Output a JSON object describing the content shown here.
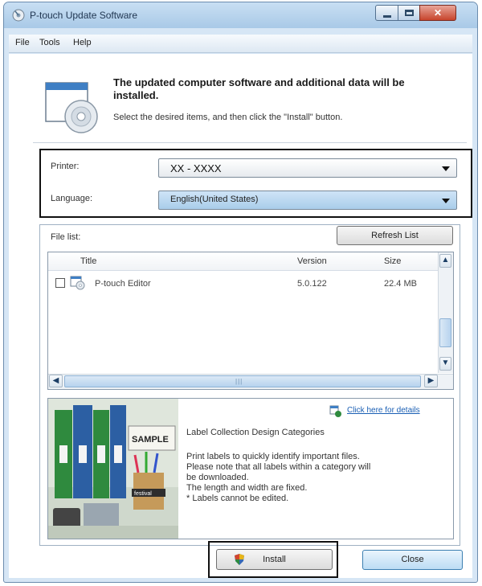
{
  "window": {
    "title": "P-touch Update Software"
  },
  "menu": {
    "items": [
      "File",
      "Tools",
      "Help"
    ]
  },
  "header": {
    "title": "The updated computer software and additional data will be installed.",
    "subtitle": "Select the desired items, and then click the \"Install\" button."
  },
  "printer": {
    "label": "Printer:",
    "value": "XX - XXXX"
  },
  "language": {
    "label": "Language:",
    "value": "English(United States)"
  },
  "file_list": {
    "label": "File list:",
    "refresh_label": "Refresh List",
    "columns": [
      "Title",
      "Version",
      "Size"
    ],
    "rows": [
      {
        "title": "P-touch Editor",
        "version": "5.0.122",
        "size": "22.4 MB"
      }
    ]
  },
  "info": {
    "link": "Click here for details",
    "title": "Label Collection Design Categories",
    "lines": [
      "Print labels to quickly identify important files.",
      "Please note that all labels within a category will",
      "be downloaded.",
      "The length and width are fixed.",
      "* Labels cannot be edited."
    ],
    "sample_label": "SAMPLE",
    "festival_label": "festival"
  },
  "buttons": {
    "install": "Install",
    "close": "Close"
  },
  "colors": {
    "accent": "#1a5fb4",
    "titlebar": "#a9c9e7",
    "close_button": "#c7442c",
    "highlight_frame": "#111111"
  }
}
